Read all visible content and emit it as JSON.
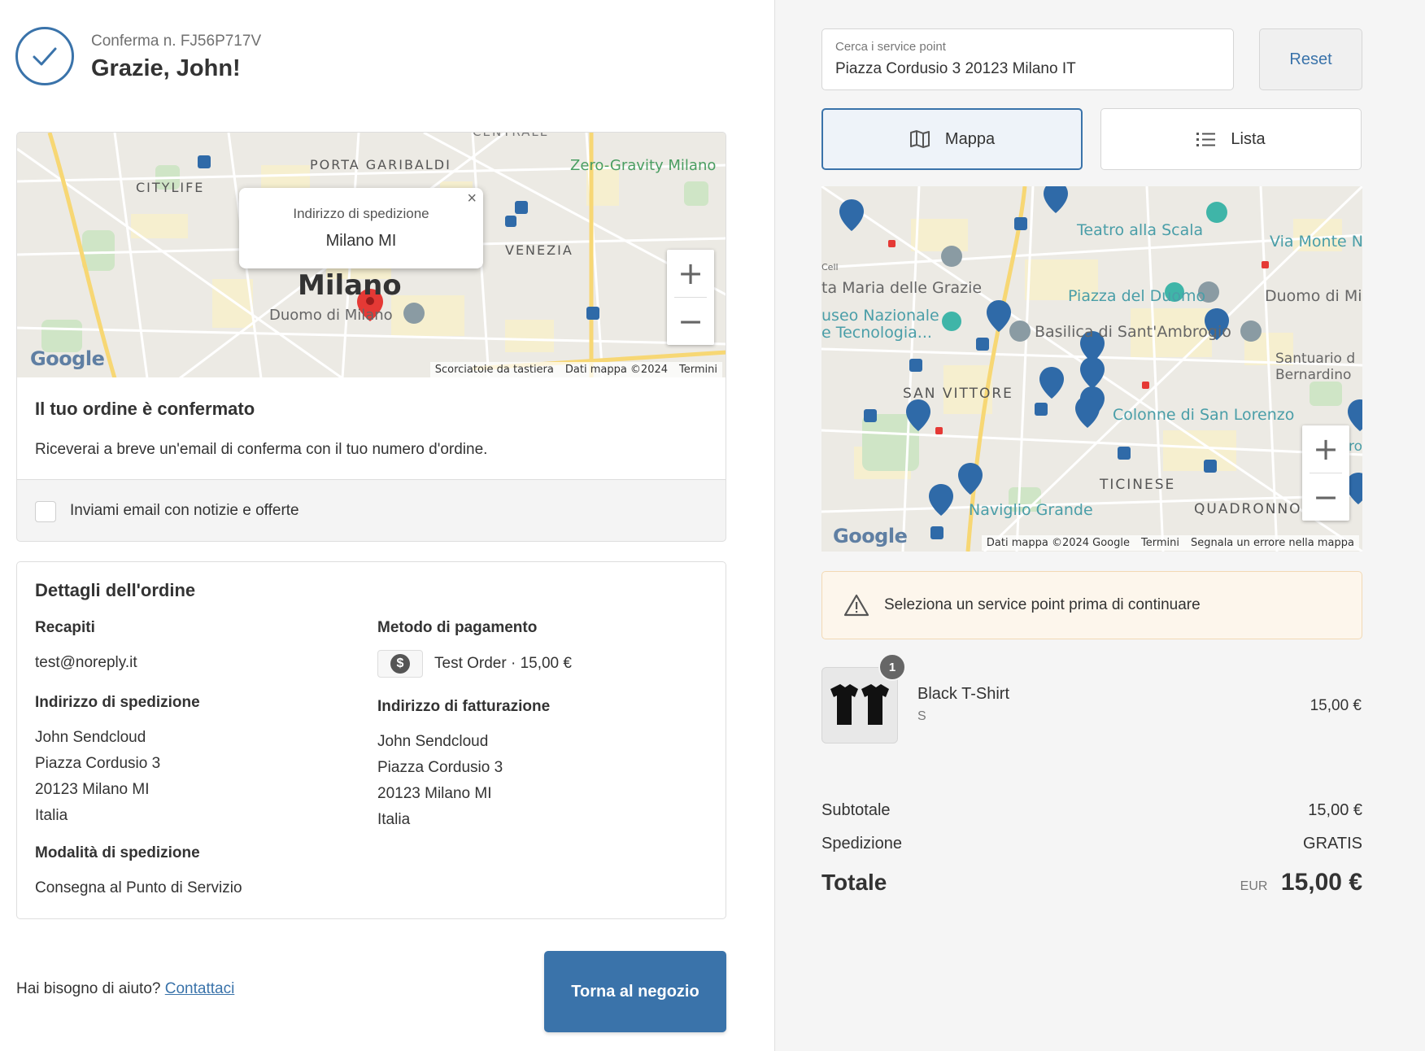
{
  "header": {
    "order_number": "Conferma n. FJ56P717V",
    "thanks": "Grazie, John!"
  },
  "left_map": {
    "labels": {
      "porta_garibaldi": "PORTA GARIBALDI",
      "citylife": "CITYLIFE",
      "zero_gravity": "Zero-Gravity Milano",
      "venezia": "VENEZIA",
      "milano": "Milano",
      "duomo": "Duomo di Milano",
      "centrale": "CENTRALE"
    },
    "popup": {
      "title": "Indirizzo di spedizione",
      "value": "Milano MI",
      "close": "×"
    },
    "zoom_in": "+",
    "zoom_out": "−",
    "google": "Google",
    "attribution": [
      "Scorciatoie da tastiera",
      "Dati mappa ©2024",
      "Termini"
    ]
  },
  "confirmation": {
    "title": "Il tuo ordine è confermato",
    "message": "Riceverai a breve un'email di conferma con il tuo numero d'ordine.",
    "newsletter_label": "Inviami email con notizie e offerte"
  },
  "order_details": {
    "title": "Dettagli dell'ordine",
    "contacts_title": "Recapiti",
    "email": "test@noreply.it",
    "payment_title": "Metodo di pagamento",
    "payment_value": "Test Order · 15,00 €",
    "shipping_address_title": "Indirizzo di spedizione",
    "shipping_address": [
      "John Sendcloud",
      "Piazza Cordusio 3",
      "20123 Milano MI",
      "Italia"
    ],
    "billing_address_title": "Indirizzo di fatturazione",
    "billing_address": [
      "John Sendcloud",
      "Piazza Cordusio 3",
      "20123 Milano MI",
      "Italia"
    ],
    "shipping_method_title": "Modalità di spedizione",
    "shipping_method": "Consegna al Punto di Servizio"
  },
  "footer": {
    "help_text": "Hai bisogno di aiuto?",
    "contact_link": "Contattaci",
    "back_button": "Torna al negozio"
  },
  "service_point": {
    "search_label": "Cerca i service point",
    "search_value": "Piazza Cordusio 3 20123 Milano IT",
    "reset": "Reset",
    "tab_map": "Mappa",
    "tab_list": "Lista"
  },
  "right_map": {
    "labels": {
      "teatro": "Teatro alla Scala",
      "via_monte": "Via Monte N",
      "maria_grazie": "ta Maria delle Grazie",
      "piazza_duomo": "Piazza del Duomo",
      "duomo": "Duomo di Mi",
      "museo1": "useo Nazionale",
      "museo2": "e Tecnologia...",
      "basilica": "Basilica di Sant'Ambrogio",
      "santuario1": "Santuario d",
      "santuario2": "Bernardino",
      "san_vittore": "SAN VITTORE",
      "colonne": "Colonne di San Lorenzo",
      "ticinese": "TICINESE",
      "quadronno": "QUADRONNO",
      "naviglio": "Naviglio Grande",
      "cell": "Cell",
      "ro": "ro"
    },
    "zoom_in": "+",
    "zoom_out": "−",
    "google": "Google",
    "attribution": [
      "Dati mappa ©2024 Google",
      "Termini",
      "Segnala un errore nella mappa"
    ]
  },
  "warning": "Seleziona un service point prima di continuare",
  "cart": {
    "quantity": "1",
    "product_name": "Black T-Shirt",
    "variant": "S",
    "price": "15,00 €"
  },
  "summary": {
    "subtotal_label": "Subtotale",
    "subtotal_value": "15,00 €",
    "shipping_label": "Spedizione",
    "shipping_value": "GRATIS",
    "total_label": "Totale",
    "currency": "EUR",
    "total_value": "15,00 €"
  },
  "colors": {
    "accent": "#3a73aa",
    "pin_blue": "#2f6aa8",
    "pin_red": "#e53935",
    "warning_bg": "#fdf6ec"
  }
}
